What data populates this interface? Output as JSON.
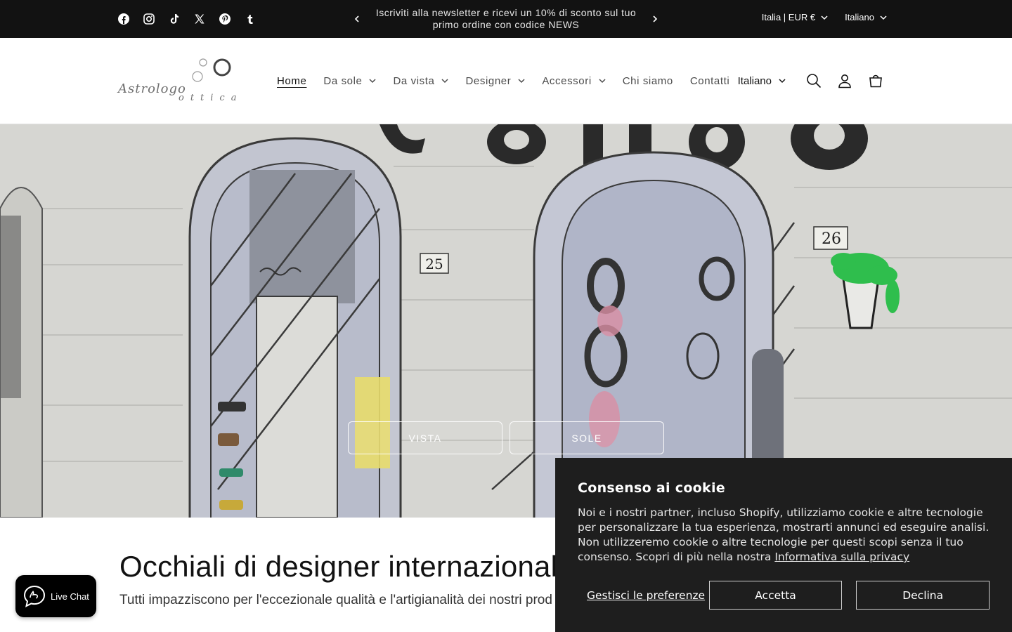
{
  "social": {
    "icons": [
      "facebook-icon",
      "instagram-icon",
      "tiktok-icon",
      "x-icon",
      "pinterest-icon",
      "tumblr-icon"
    ]
  },
  "announcement": {
    "text": "Iscriviti alla newsletter e ricevi un 10% di sconto sul tuo primo ordine con codice NEWS"
  },
  "localization": {
    "country": "Italia | EUR €",
    "language": "Italiano"
  },
  "header": {
    "logo_word1": "Astrologo",
    "logo_word2": "ottica",
    "nav": [
      {
        "label": "Home",
        "active": true,
        "dropdown": false
      },
      {
        "label": "Da sole",
        "dropdown": true
      },
      {
        "label": "Da vista",
        "dropdown": true
      },
      {
        "label": "Designer",
        "dropdown": true
      },
      {
        "label": "Accessori",
        "dropdown": true
      },
      {
        "label": "Chi siamo",
        "dropdown": false
      },
      {
        "label": "Contatti",
        "dropdown": false
      }
    ],
    "language": "Italiano"
  },
  "hero": {
    "btn_vista": "VISTA",
    "btn_sole": "SOLE",
    "numbers": [
      "25",
      "26"
    ]
  },
  "intro": {
    "title": "Occhiali di designer internazionali",
    "text": "Tutti impazziscono per l'eccezionale qualità e l'artigianalità dei nostri prod"
  },
  "cookie": {
    "title": "Consenso ai cookie",
    "body": "Noi e i nostri partner, incluso Shopify, utilizziamo cookie e altre tecnologie per personalizzare la tua esperienza, mostrarti annunci ed eseguire analisi. Non utilizzeremo cookie o altre tecnologie per questi scopi senza il tuo consenso. Scopri di più nella nostra ",
    "privacy_link": "Informativa sulla privacy",
    "manage": "Gestisci le preferenze",
    "accept": "Accetta",
    "decline": "Declina"
  },
  "chat": {
    "label": "Live Chat"
  }
}
